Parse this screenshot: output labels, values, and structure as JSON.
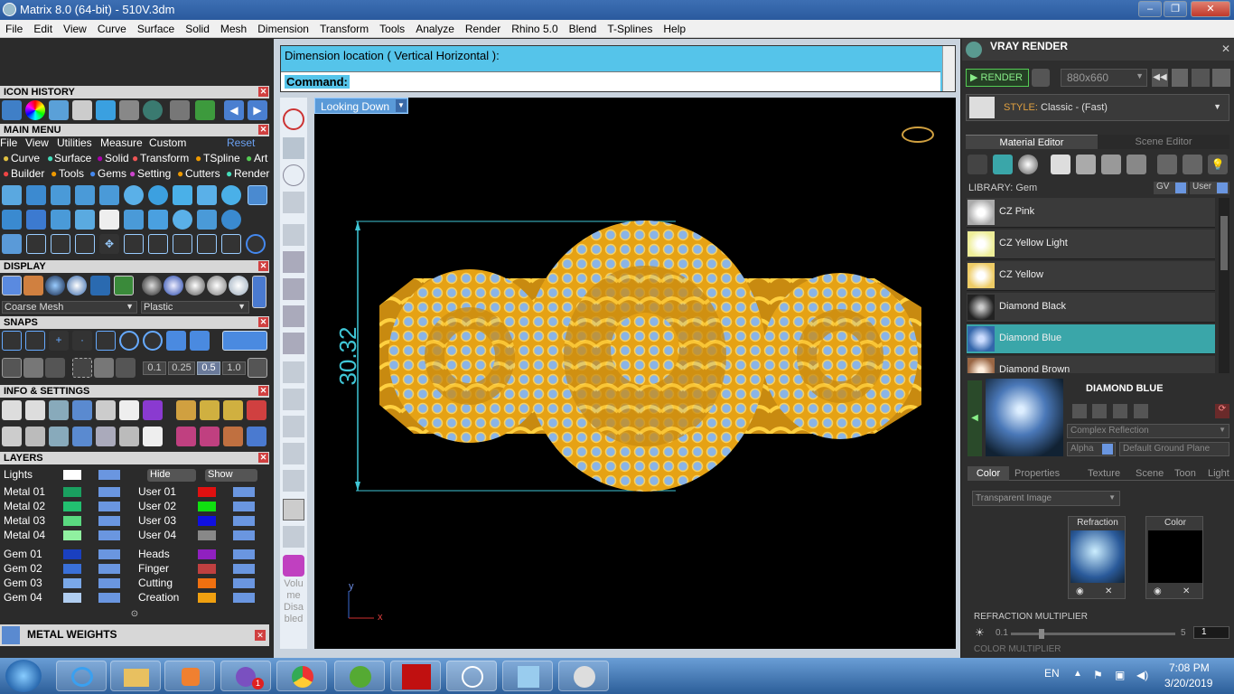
{
  "window": {
    "title": "Matrix 8.0 (64-bit) - 510V.3dm"
  },
  "menu": [
    "File",
    "Edit",
    "View",
    "Curve",
    "Surface",
    "Solid",
    "Mesh",
    "Dimension",
    "Transform",
    "Tools",
    "Analyze",
    "Render",
    "Rhino 5.0",
    "Blend",
    "T-Splines",
    "Help"
  ],
  "left": {
    "icon_history": "ICON HISTORY",
    "main_menu": "MAIN MENU",
    "main_menu_row1": [
      "File",
      "View",
      "Utilities",
      "Measure",
      "Custom"
    ],
    "reset": "Reset",
    "main_menu_row2": [
      "Curve",
      "Surface",
      "Solid",
      "Transform",
      "TSpline",
      "Art"
    ],
    "main_menu_row3": [
      "Builder",
      "Tools",
      "Gems",
      "Setting",
      "Cutters",
      "Render"
    ],
    "display": "DISPLAY",
    "display_mesh": "Coarse Mesh",
    "display_material": "Plastic",
    "snaps": "SNAPS",
    "snap_values": [
      "0.1",
      "0.25",
      "0.5",
      "1.0"
    ],
    "info": "INFO & SETTINGS",
    "layers": "LAYERS",
    "lights": "Lights",
    "hide": "Hide",
    "show": "Show",
    "layers_left": [
      "Metal 01",
      "Metal 02",
      "Metal 03",
      "Metal 04",
      "Gem 01",
      "Gem 02",
      "Gem 03",
      "Gem 04"
    ],
    "layers_right": [
      "User 01",
      "User 02",
      "User 03",
      "User 04",
      "Heads",
      "Finger",
      "Cutting",
      "Creation"
    ],
    "metal_weights": "METAL WEIGHTS"
  },
  "command": {
    "prompt": "Dimension location ( Vertical  Horizontal ):",
    "label": "Command:",
    "value": ""
  },
  "viewport": {
    "view": "Looking Down",
    "dimension": "30.32",
    "axis_x": "x",
    "axis_y": "y"
  },
  "vtool": {
    "status": "Volume Disabled"
  },
  "vray": {
    "title": "VRAY RENDER",
    "render": "RENDER",
    "size": "880x660",
    "style_label": "STYLE:",
    "style": "Classic - (Fast)",
    "tab_material": "Material Editor",
    "tab_scene": "Scene Editor",
    "library": "LIBRARY: Gem",
    "gv": "GV",
    "user": "User",
    "materials": [
      "CZ Pink",
      "CZ Yellow Light",
      "CZ Yellow",
      "Diamond Black",
      "Diamond Blue",
      "Diamond Brown"
    ],
    "selected": "DIAMOND BLUE",
    "reflection": "Complex Reflection",
    "alpha": "Alpha",
    "ground": "Default Ground Plane",
    "subtabs": [
      "Color",
      "Properties",
      "Texture",
      "Scene",
      "Toon",
      "Light"
    ],
    "transparent": "Transparent Image",
    "refraction": "Refraction",
    "color": "Color",
    "refraction_multiplier": "REFRACTION MULTIPLIER",
    "rm_min": "0.1",
    "rm_max": "5",
    "rm_value": "1",
    "color_multiplier": "COLOR MULTIPLIER"
  },
  "taskbar": {
    "lang": "EN",
    "time": "7:08 PM",
    "date": "3/20/2019",
    "badge": "1"
  },
  "colors": {
    "gold": "#f0b81a",
    "gem": "#8ab4e6",
    "cmd": "#55c4ea",
    "dim": "#3fc6d6",
    "select": "#3aa6a9"
  }
}
